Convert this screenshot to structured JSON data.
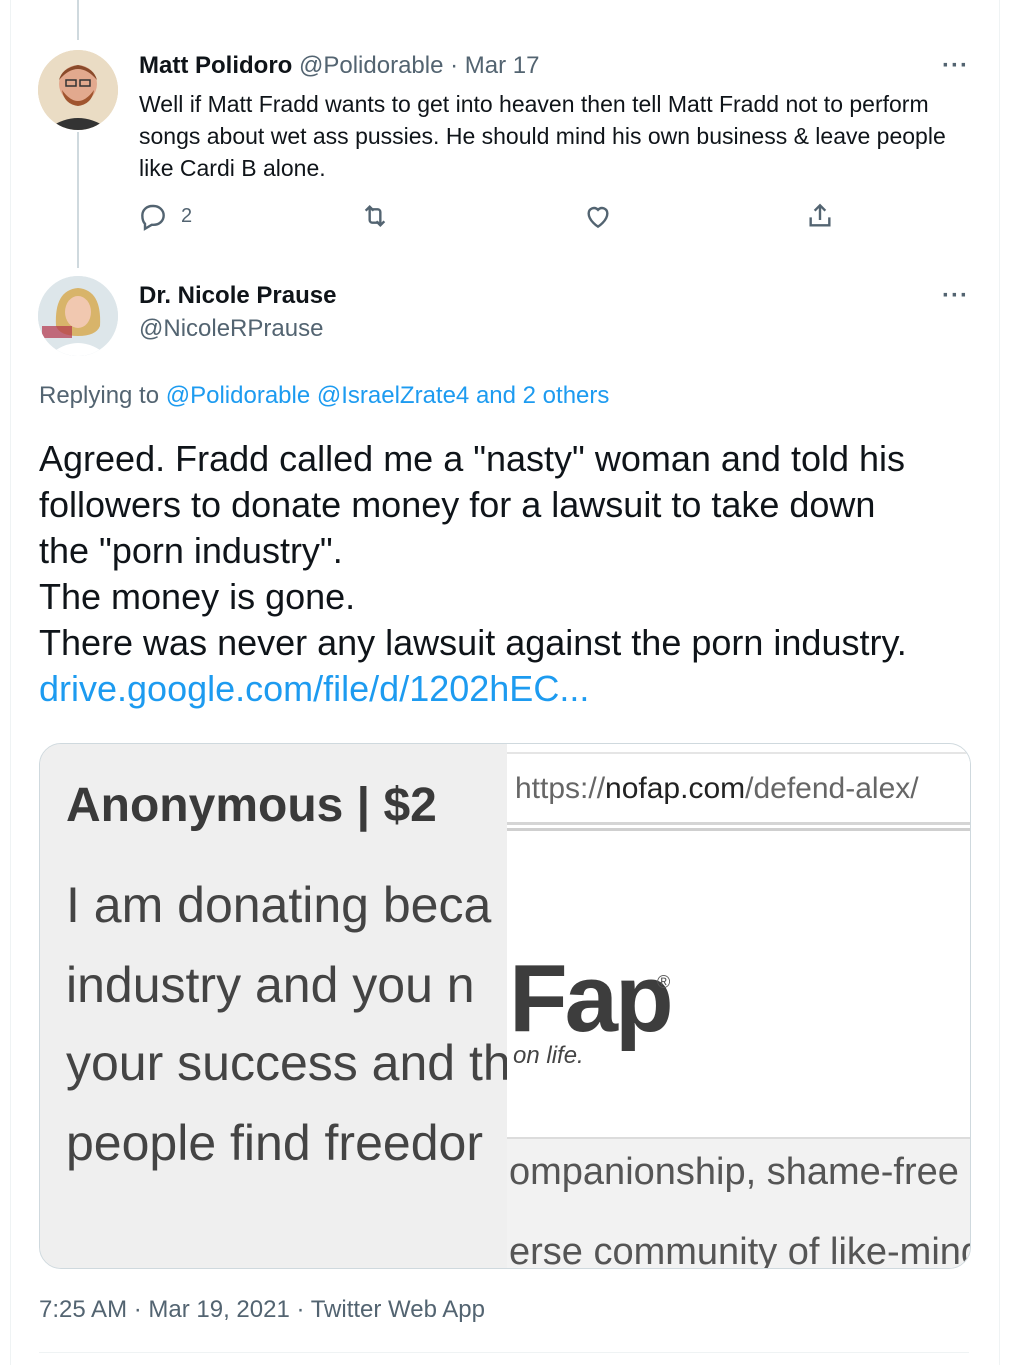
{
  "parent_tweet": {
    "author_name": "Matt Polidoro",
    "handle": "@Polidorable",
    "separator": "·",
    "date": "Mar 17",
    "text": "Well if Matt Fradd wants to get into heaven then tell Matt Fradd not to perform songs about wet ass pussies. He should mind his own business & leave people like Cardi B alone.",
    "reply_count": "2",
    "more_label": "···"
  },
  "main_tweet": {
    "author_name": "Dr. Nicole Prause",
    "handle": "@NicoleRPrause",
    "more_label": "···",
    "replying_prefix": "Replying to",
    "replying_to": "@Polidorable @IsraelZrate4 and 2 others",
    "text_lines": [
      "Agreed. Fradd called me a \"nasty\" woman and told his",
      "followers to donate money for a lawsuit to take down",
      "the \"porn industry\".",
      "The money is gone.",
      "There was never any lawsuit against the porn industry."
    ],
    "link": "drive.google.com/file/d/1202hEC...",
    "timestamp": "7:25 AM · Mar 19, 2021 · Twitter Web App"
  },
  "media": {
    "left_heading": "Anonymous | $2",
    "left_lines": [
      "I am donating beca",
      "industry and you n",
      "your success and th",
      "people find freedor"
    ],
    "url_prefix": "https://",
    "url_domain": "nofap.com",
    "url_path": "/defend-alex/",
    "logo_text": "Fap",
    "logo_mark": "®",
    "tagline": "on life.",
    "grey_lines": [
      "ompanionship, shame-free a",
      "erse community of like-mind"
    ]
  },
  "colors": {
    "link": "#1d9bf0",
    "muted": "#536471",
    "text": "#0f1419",
    "border": "#cfd9de"
  },
  "icons": [
    "reply-icon",
    "retweet-icon",
    "like-icon",
    "share-icon",
    "more-icon"
  ]
}
